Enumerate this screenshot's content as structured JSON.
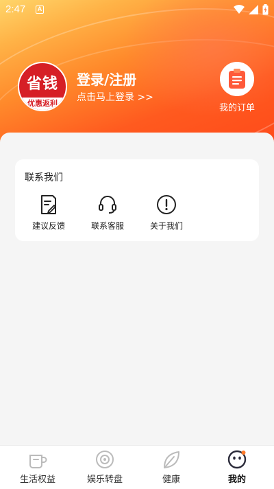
{
  "status_bar": {
    "time": "2:47",
    "notification_icon": "A"
  },
  "profile": {
    "avatar_top_text": "省钱",
    "avatar_bottom_text": "优惠返利",
    "login_title": "登录/注册",
    "login_subtitle": "点击马上登录 >>"
  },
  "orders": {
    "label": "我的订单"
  },
  "contact_card": {
    "title": "联系我们",
    "items": [
      {
        "label": "建议反馈",
        "icon": "feedback-icon"
      },
      {
        "label": "联系客服",
        "icon": "headset-icon"
      },
      {
        "label": "关于我们",
        "icon": "info-icon"
      }
    ]
  },
  "tabbar": {
    "tabs": [
      {
        "label": "生活权益",
        "icon": "coffee-icon"
      },
      {
        "label": "娱乐转盘",
        "icon": "wheel-icon"
      },
      {
        "label": "健康",
        "icon": "leaf-icon"
      },
      {
        "label": "我的",
        "icon": "profile-face-icon",
        "active": true
      }
    ]
  },
  "colors": {
    "accent": "#ff5a1f",
    "brand_red": "#d61f26",
    "background": "#f5f5f5"
  }
}
